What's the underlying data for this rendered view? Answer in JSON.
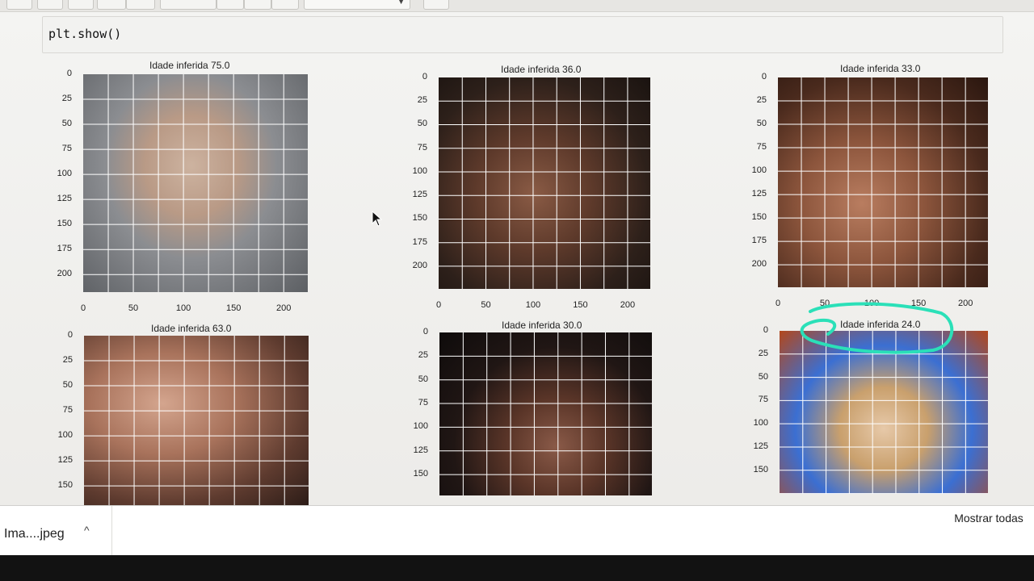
{
  "code_cell": {
    "text": "plt.show()"
  },
  "subplots": [
    {
      "title": "Idade inferida 75.0",
      "yticks": [
        "0",
        "25",
        "50",
        "75",
        "100",
        "125",
        "150",
        "175",
        "200"
      ],
      "xticks": [
        "0",
        "50",
        "100",
        "150",
        "200"
      ],
      "photo": "elderly-woman-face"
    },
    {
      "title": "Idade inferida 36.0",
      "yticks": [
        "0",
        "25",
        "50",
        "75",
        "100",
        "125",
        "150",
        "175",
        "200"
      ],
      "xticks": [
        "0",
        "50",
        "100",
        "150",
        "200"
      ],
      "photo": "young-man-face"
    },
    {
      "title": "Idade inferida 33.0",
      "yticks": [
        "0",
        "25",
        "50",
        "75",
        "100",
        "125",
        "150",
        "175",
        "200"
      ],
      "xticks": [
        "0",
        "50",
        "100",
        "150",
        "200"
      ],
      "photo": "man-face"
    },
    {
      "title": "Idade inferida 63.0",
      "yticks": [
        "0",
        "25",
        "50",
        "75",
        "100",
        "125",
        "150"
      ],
      "xticks": [],
      "photo": "bald-man-face"
    },
    {
      "title": "Idade inferida 30.0",
      "yticks": [
        "0",
        "25",
        "50",
        "75",
        "100",
        "125",
        "150"
      ],
      "xticks": [],
      "photo": "woman-face"
    },
    {
      "title": "Idade inferida 24.0",
      "yticks": [
        "0",
        "25",
        "50",
        "75",
        "100",
        "125",
        "150"
      ],
      "xticks": [],
      "photo": "child-face"
    }
  ],
  "download_bar": {
    "file_name": "Ima....jpeg",
    "show_all_label": "Mostrar todas"
  },
  "colors": {
    "annotation": "#2be0b8",
    "grid": "#ffffff"
  }
}
